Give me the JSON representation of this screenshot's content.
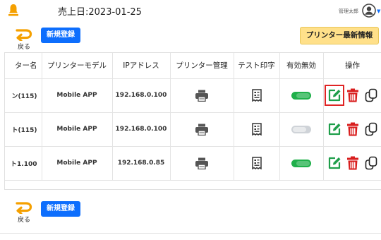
{
  "header": {
    "sales_date": "売上日:2023-01-25",
    "user_name": "管理太郎",
    "bell_icon": "bell-icon",
    "avatar_icon": "user-avatar-icon"
  },
  "toolbar": {
    "back_label": "戻る",
    "new_label": "新規登録",
    "printer_info_label": "プリンター最新情報"
  },
  "table": {
    "columns": [
      "ター名",
      "プリンターモデル",
      "IPアドレス",
      "プリンター管理",
      "テスト印字",
      "有効無効",
      "操作"
    ],
    "rows": [
      {
        "name": "ン(115)",
        "model": "Mobile APP",
        "ip": "192.168.0.100",
        "enabled": true
      },
      {
        "name": "ト(115)",
        "model": "Mobile APP",
        "ip": "192.168.0.100",
        "enabled": false
      },
      {
        "name": "ト1.100",
        "model": "Mobile APP",
        "ip": "192.168.0.85",
        "enabled": true
      }
    ]
  },
  "colors": {
    "primary": "#0d6efd",
    "accent_yellow": "#ffe08a",
    "bell_orange": "#f5a000",
    "toggle_on": "#20b04b",
    "toggle_off": "#cfd3d8",
    "edit_green": "#1e9e4a",
    "delete_red": "#d81e1e",
    "highlight_red": "#e02424"
  }
}
